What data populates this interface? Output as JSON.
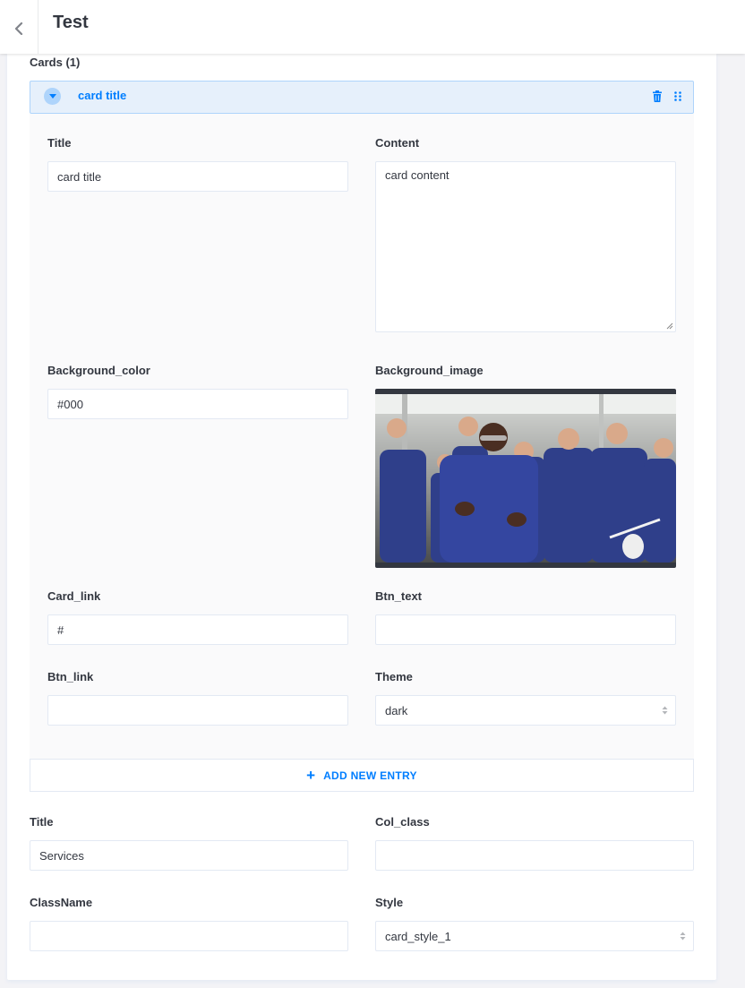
{
  "header": {
    "title": "Test"
  },
  "cards": {
    "label": "Cards (1)",
    "item_title": "card title",
    "fields": {
      "title": {
        "label": "Title",
        "value": "card title"
      },
      "content": {
        "label": "Content",
        "value": "card content"
      },
      "background_color": {
        "label": "Background_color",
        "value": "#000"
      },
      "background_image": {
        "label": "Background_image"
      },
      "card_link": {
        "label": "Card_link",
        "value": "#"
      },
      "btn_text": {
        "label": "Btn_text",
        "value": ""
      },
      "btn_link": {
        "label": "Btn_link",
        "value": ""
      },
      "theme": {
        "label": "Theme",
        "value": "dark"
      }
    },
    "add_entry_label": "ADD NEW ENTRY"
  },
  "section": {
    "title": {
      "label": "Title",
      "value": "Services"
    },
    "col_class": {
      "label": "Col_class",
      "value": ""
    },
    "classname": {
      "label": "ClassName",
      "value": ""
    },
    "style": {
      "label": "Style",
      "value": "card_style_1"
    }
  },
  "colors": {
    "accent": "#007eff",
    "header_bg": "#e6f0fb",
    "header_border": "#aed4fb",
    "border": "#e3e9f3"
  },
  "icons": [
    "chevron-left-icon",
    "caret-down-icon",
    "trash-icon",
    "drag-handle-icon",
    "plus-icon",
    "select-arrows-icon",
    "resize-grip-icon"
  ]
}
